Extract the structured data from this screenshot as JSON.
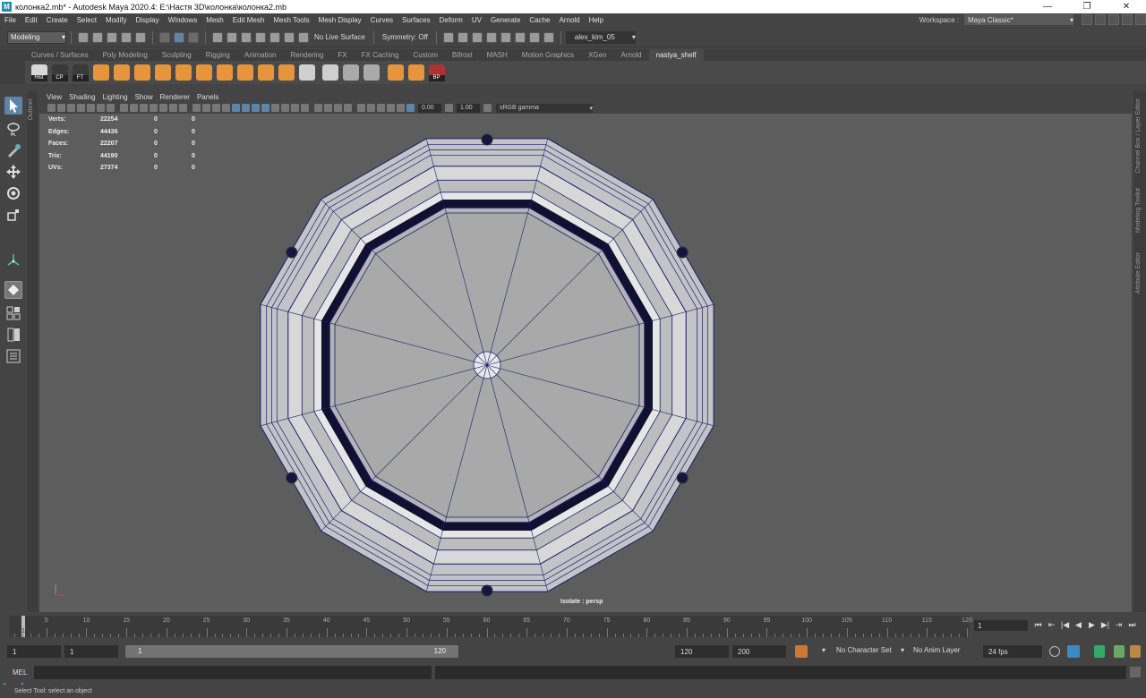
{
  "window": {
    "title": "колонка2.mb* - Autodesk Maya 2020.4: E:\\Настя 3D\\колонка\\колонка2.mb",
    "minimize": "—",
    "maximize": "❐",
    "close": "✕"
  },
  "menu": [
    "File",
    "Edit",
    "Create",
    "Select",
    "Modify",
    "Display",
    "Windows",
    "Mesh",
    "Edit Mesh",
    "Mesh Tools",
    "Mesh Display",
    "Curves",
    "Surfaces",
    "Deform",
    "UV",
    "Generate",
    "Cache",
    "Arnold",
    "Help"
  ],
  "workspace": {
    "label": "Workspace :",
    "value": "Maya Classic*"
  },
  "status": {
    "mode": "Modeling",
    "live_surface": "No Live Surface",
    "symmetry": "Symmetry: Off",
    "user": "alex_kim_05"
  },
  "shelf_tabs": [
    "Curves / Surfaces",
    "Poly Modeling",
    "Sculpting",
    "Rigging",
    "Animation",
    "Rendering",
    "FX",
    "FX Caching",
    "Custom",
    "Bifrost",
    "MASH",
    "Motion Graphics",
    "XGen",
    "Arnold",
    "nastya_shelf"
  ],
  "shelf_active": "nastya_shelf",
  "shelf_icons": [
    {
      "name": "hist",
      "caption": "Hist",
      "color": "#d9d9d9"
    },
    {
      "name": "cp",
      "caption": "CP",
      "color": "#3a3a3a"
    },
    {
      "name": "ft",
      "caption": "FT",
      "color": "#3a3a3a"
    },
    {
      "name": "poly-a",
      "caption": "",
      "color": "#e6953c"
    },
    {
      "name": "poly-b",
      "caption": "",
      "color": "#e6953c"
    },
    {
      "name": "poly-c",
      "caption": "",
      "color": "#e6953c"
    },
    {
      "name": "cube",
      "caption": "",
      "color": "#e6953c"
    },
    {
      "name": "cubes",
      "caption": "",
      "color": "#e6953c"
    },
    {
      "name": "boolean",
      "caption": "",
      "color": "#e6953c"
    },
    {
      "name": "extract",
      "caption": "",
      "color": "#e6953c"
    },
    {
      "name": "separate",
      "caption": "",
      "color": "#e6953c"
    },
    {
      "name": "bevel",
      "caption": "",
      "color": "#e6953c"
    },
    {
      "name": "bridge",
      "caption": "",
      "color": "#e6953c"
    },
    {
      "name": "sphere",
      "caption": "",
      "color": "#cfcfcf"
    },
    {
      "name": "multicut",
      "caption": "",
      "color": "#cfcfcf"
    },
    {
      "name": "grid-a",
      "caption": "",
      "color": "#aaaaaa"
    },
    {
      "name": "grid-b",
      "caption": "",
      "color": "#aaaaaa"
    },
    {
      "name": "box-a",
      "caption": "",
      "color": "#e6953c"
    },
    {
      "name": "box-b",
      "caption": "",
      "color": "#e6953c"
    },
    {
      "name": "bp",
      "caption": "BP",
      "color": "#a33"
    }
  ],
  "panel_menu": [
    "View",
    "Shading",
    "Lighting",
    "Show",
    "Renderer",
    "Panels"
  ],
  "panel_tools": {
    "exposure": "0.00",
    "gamma": "1.00",
    "color_space": "sRGB gamma"
  },
  "hud": [
    {
      "label": "Verts:",
      "v1": "22254",
      "v2": "0",
      "v3": "0"
    },
    {
      "label": "Edges:",
      "v1": "44436",
      "v2": "0",
      "v3": "0"
    },
    {
      "label": "Faces:",
      "v1": "22207",
      "v2": "0",
      "v3": "0"
    },
    {
      "label": "Tris:",
      "v1": "44190",
      "v2": "0",
      "v3": "0"
    },
    {
      "label": "UVs:",
      "v1": "27374",
      "v2": "0",
      "v3": "0"
    }
  ],
  "camera_label": "Isolate : persp",
  "side_tabs": {
    "outliner": "Outliner",
    "right": [
      "Channel Box / Layer Editor",
      "Modeling Toolkit",
      "Attribute Editor"
    ]
  },
  "timeline": {
    "labels": [
      "5",
      "10",
      "15",
      "20",
      "25",
      "30",
      "35",
      "40",
      "45",
      "50",
      "55",
      "60",
      "65",
      "70",
      "75",
      "80",
      "85",
      "90",
      "95",
      "100",
      "105",
      "110",
      "115",
      "120"
    ],
    "current_frame": "1",
    "current_field": "1",
    "play_icons": [
      "⏮",
      "⇤",
      "|◀",
      "◀",
      "▶",
      "▶|",
      "⇥",
      "⏭"
    ]
  },
  "range": {
    "start": "1",
    "anim_start": "1",
    "slider_start": "1",
    "slider_end": "120",
    "end": "120",
    "anim_end": "200",
    "character_set": "No Character Set",
    "anim_layer": "No Anim Layer",
    "fps": "24 fps"
  },
  "cmdline": {
    "label": "MEL"
  },
  "helpline": "Select Tool: select an object"
}
